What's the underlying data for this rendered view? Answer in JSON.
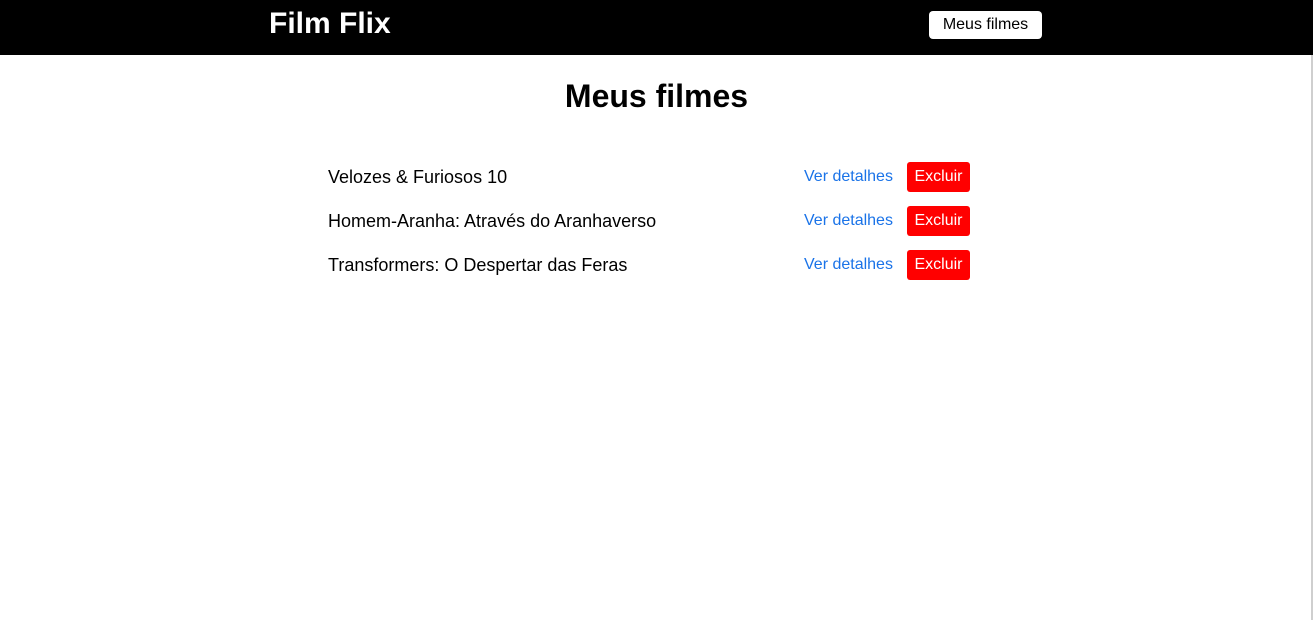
{
  "header": {
    "brand": "Film Flix",
    "nav_button_label": "Meus filmes"
  },
  "main": {
    "title": "Meus filmes",
    "movies": [
      {
        "title": "Velozes & Furiosos 10",
        "details_label": "Ver detalhes",
        "delete_label": "Excluir"
      },
      {
        "title": "Homem-Aranha: Através do Aranhaverso",
        "details_label": "Ver detalhes",
        "delete_label": "Excluir"
      },
      {
        "title": "Transformers: O Despertar das Feras",
        "details_label": "Ver detalhes",
        "delete_label": "Excluir"
      }
    ]
  },
  "colors": {
    "header_bg": "#000000",
    "link": "#1a73e8",
    "delete_bg": "#ff0000"
  }
}
